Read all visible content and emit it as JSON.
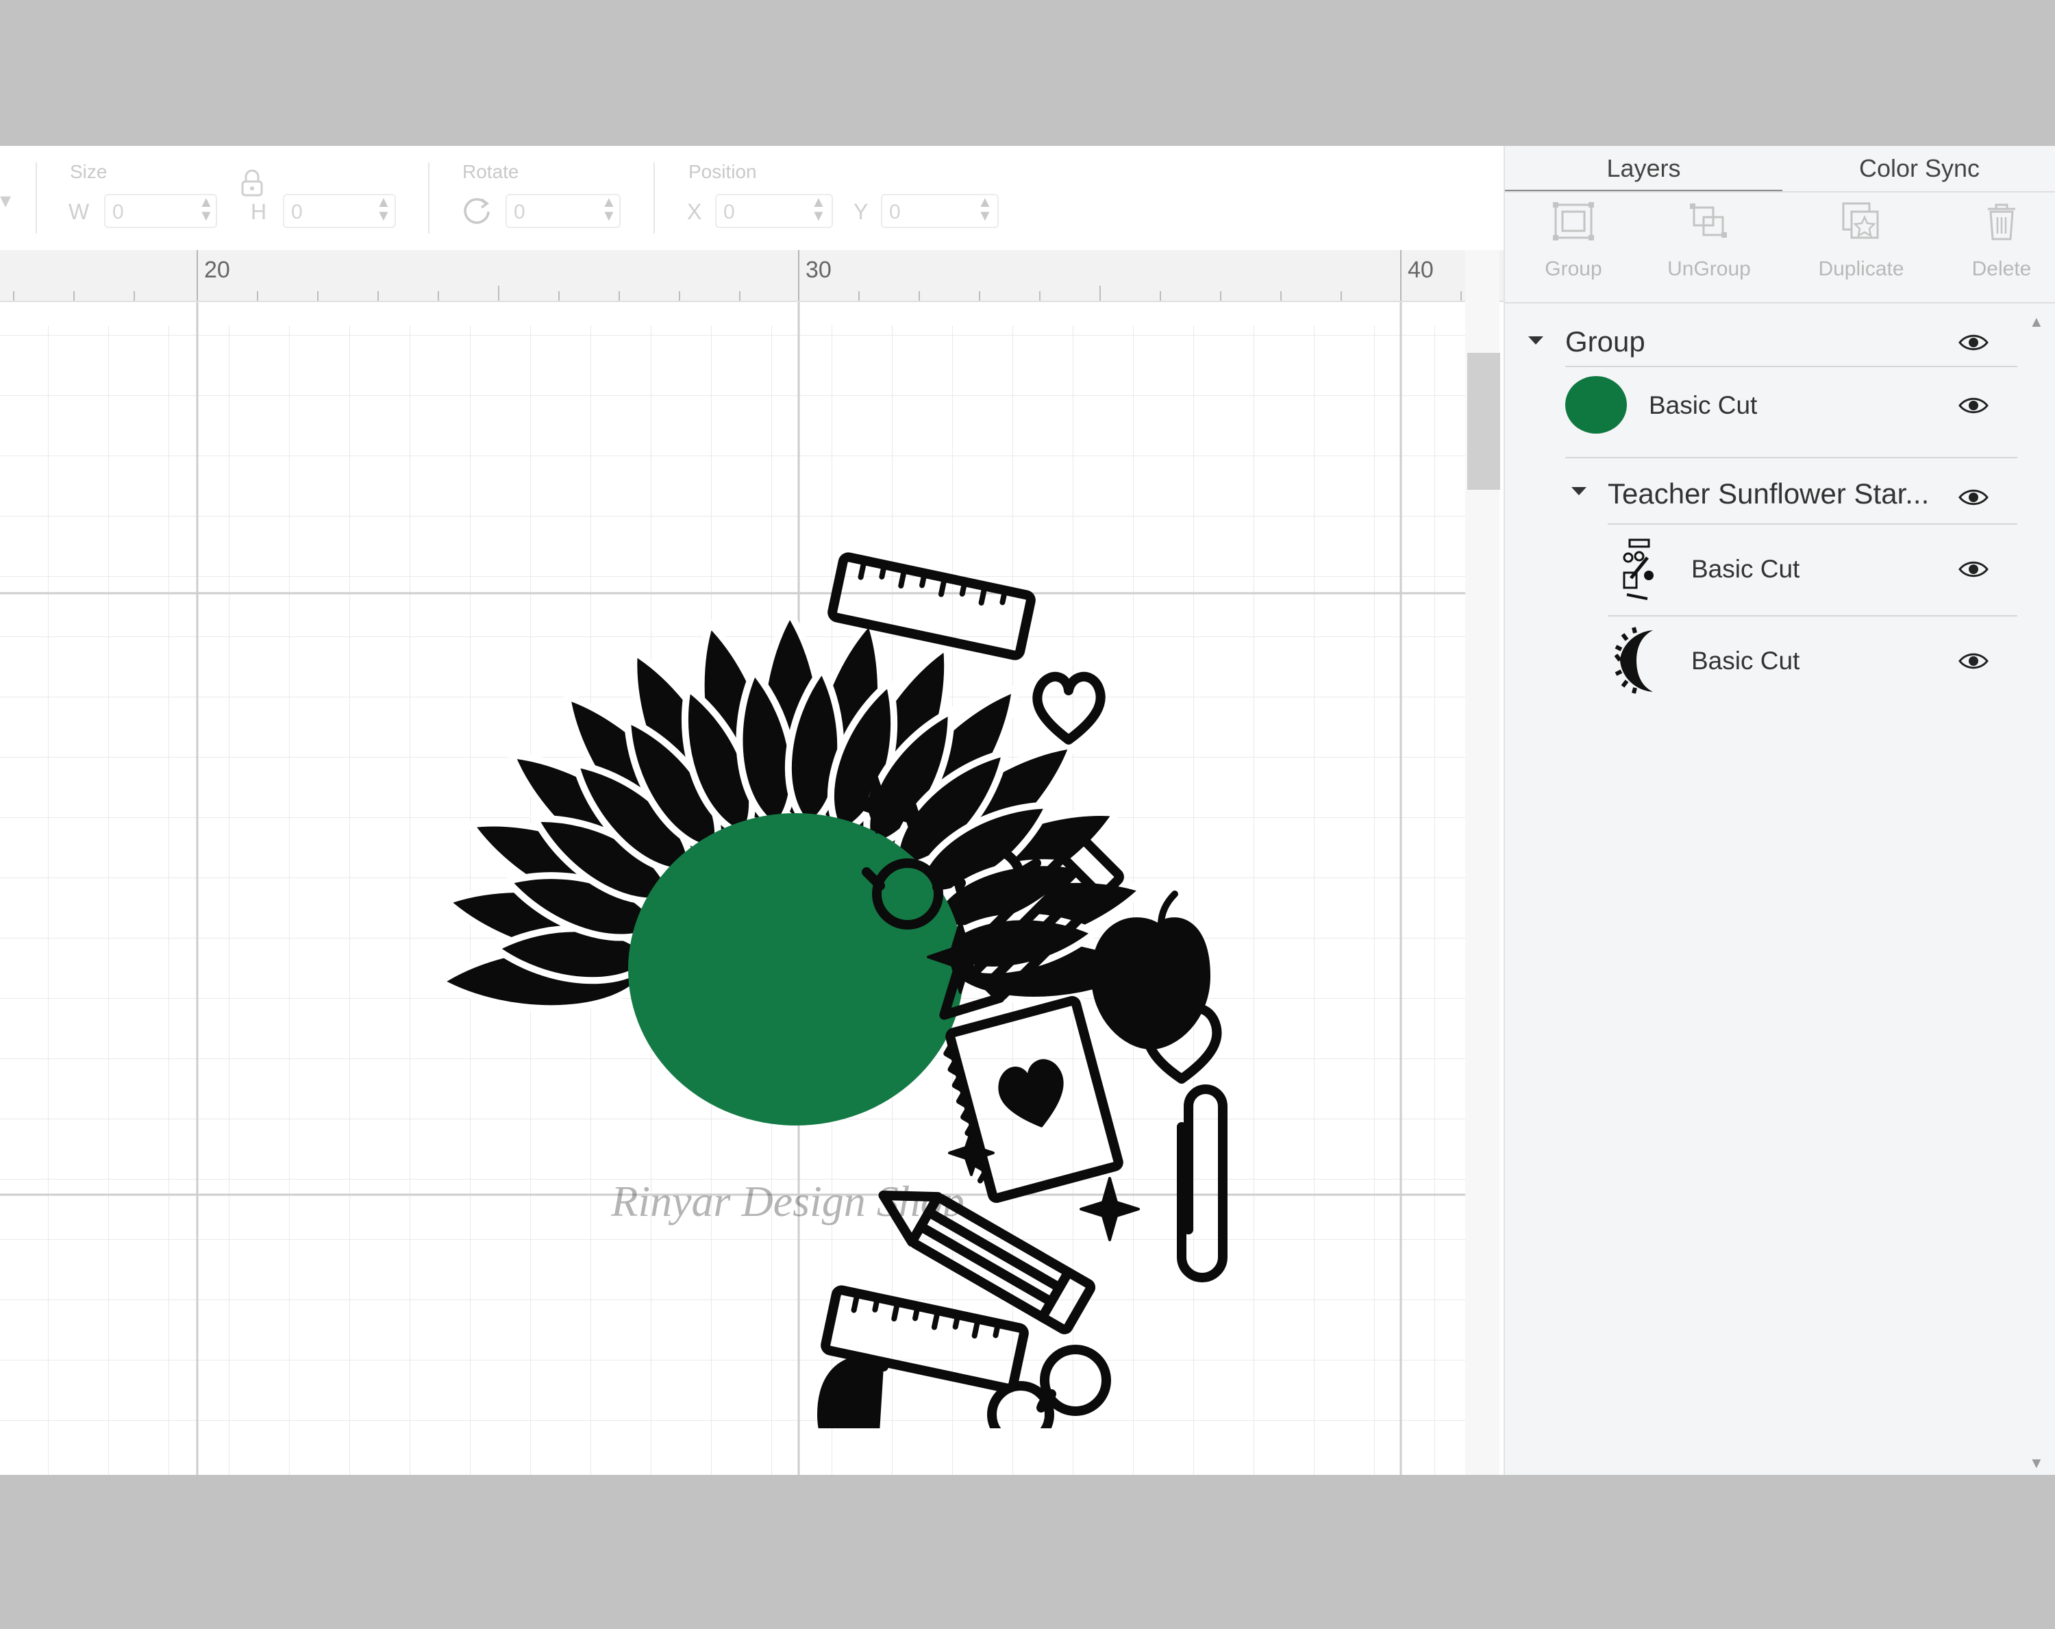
{
  "toolbar": {
    "size_label": "Size",
    "w_label": "W",
    "w_value": "0",
    "h_label": "H",
    "h_value": "0",
    "rotate_label": "Rotate",
    "rotate_value": "0",
    "position_label": "Position",
    "x_label": "X",
    "x_value": "0",
    "y_label": "Y",
    "y_value": "0"
  },
  "ruler": {
    "marks": [
      "20",
      "30",
      "40"
    ]
  },
  "panel": {
    "tabs": [
      {
        "label": "Layers",
        "active": true
      },
      {
        "label": "Color Sync",
        "active": false
      }
    ],
    "actions": [
      {
        "label": "Group",
        "icon": "group-icon"
      },
      {
        "label": "UnGroup",
        "icon": "ungroup-icon"
      },
      {
        "label": "Duplicate",
        "icon": "duplicate-icon"
      },
      {
        "label": "Delete",
        "icon": "trash-icon"
      }
    ],
    "layers": {
      "group_name": "Group",
      "circle_layer": {
        "label": "Basic Cut",
        "swatch_color": "#0f7841"
      },
      "subgroup_name": "Teacher Sunflower Star...",
      "items": [
        {
          "label": "Basic Cut",
          "thumb": "teacher-icons-thumb"
        },
        {
          "label": "Basic Cut",
          "thumb": "sunflower-petals-thumb"
        }
      ]
    }
  },
  "design": {
    "center_color": "#147a45",
    "ink_color": "#0b0b0b",
    "watermark": "Rinyar Design Shop"
  }
}
